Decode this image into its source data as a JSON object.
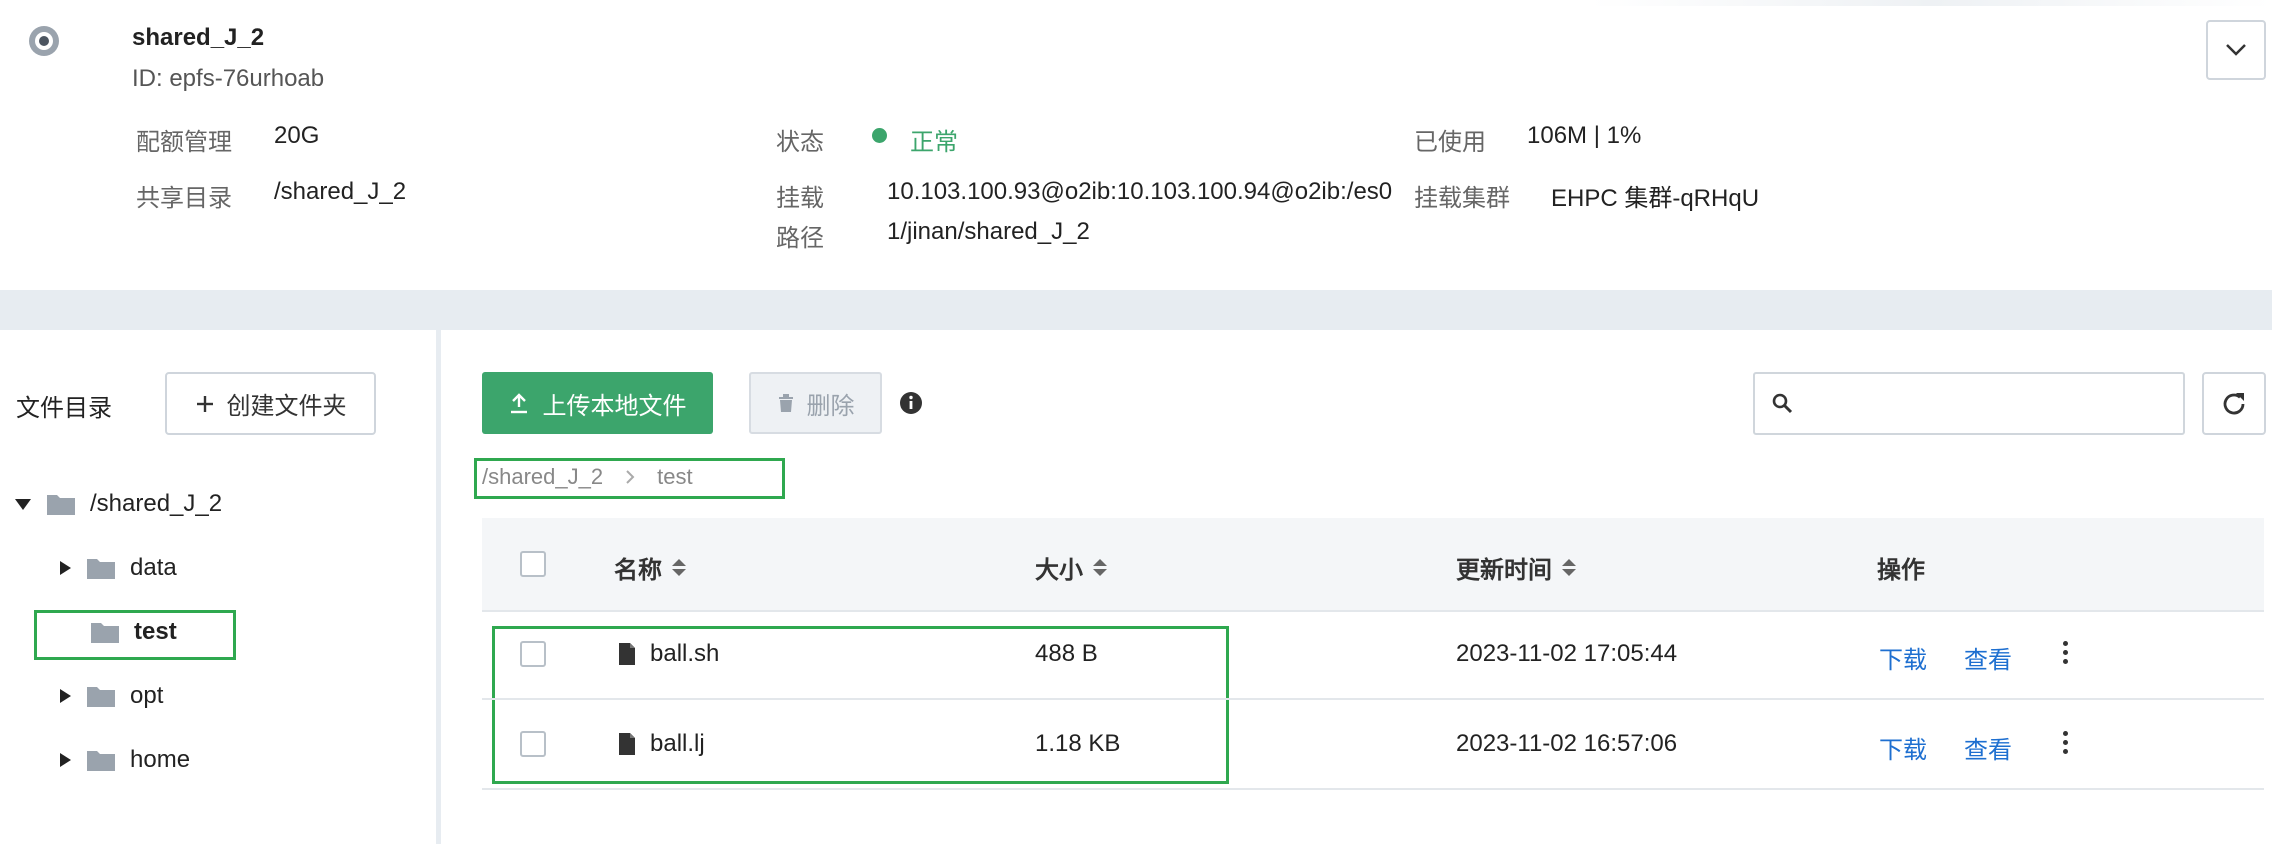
{
  "fs": {
    "name": "shared_J_2",
    "id_text": "ID: epfs-76urhoab",
    "quota_label": "配额管理",
    "quota_value": "20G",
    "share_dir_label": "共享目录",
    "share_dir_value": "/shared_J_2",
    "status_label": "状态",
    "status_value": "正常",
    "mount_label_1": "挂载",
    "mount_label_2": "路径",
    "mount_path_line1": "10.103.100.93@o2ib:10.103.100.94@o2ib:/es0",
    "mount_path_line2": "1/jinan/shared_J_2",
    "used_label": "已使用",
    "used_value": "106M | 1%",
    "cluster_label": "挂载集群",
    "cluster_value": "EHPC 集群-qRHqU",
    "status_color": "#3ca56c"
  },
  "left": {
    "title": "文件目录",
    "create_folder": "创建文件夹",
    "tree": {
      "root": "/shared_J_2",
      "children": [
        "data",
        "test",
        "opt",
        "home"
      ]
    }
  },
  "toolbar": {
    "upload": "上传本地文件",
    "delete": "删除",
    "search_placeholder": ""
  },
  "breadcrumb": {
    "root": "/shared_J_2",
    "current": "test"
  },
  "table": {
    "headers": {
      "name": "名称",
      "size": "大小",
      "updated": "更新时间",
      "actions": "操作"
    },
    "rows": [
      {
        "name": "ball.sh",
        "size": "488 B",
        "updated": "2023-11-02 17:05:44",
        "download": "下载",
        "view": "查看"
      },
      {
        "name": "ball.lj",
        "size": "1.18 KB",
        "updated": "2023-11-02 16:57:06",
        "download": "下载",
        "view": "查看"
      }
    ]
  },
  "colors": {
    "accent_green": "#3ca56c",
    "link_blue": "#1e6fd0",
    "highlight_green": "#2fa84f"
  },
  "icons": [
    "disk-icon",
    "chevron-down-icon",
    "plus-icon",
    "folder-icon",
    "caret-down-icon",
    "caret-right-icon",
    "upload-icon",
    "trash-icon",
    "info-icon",
    "search-icon",
    "refresh-icon",
    "file-icon",
    "sort-icon",
    "more-vertical-icon"
  ]
}
